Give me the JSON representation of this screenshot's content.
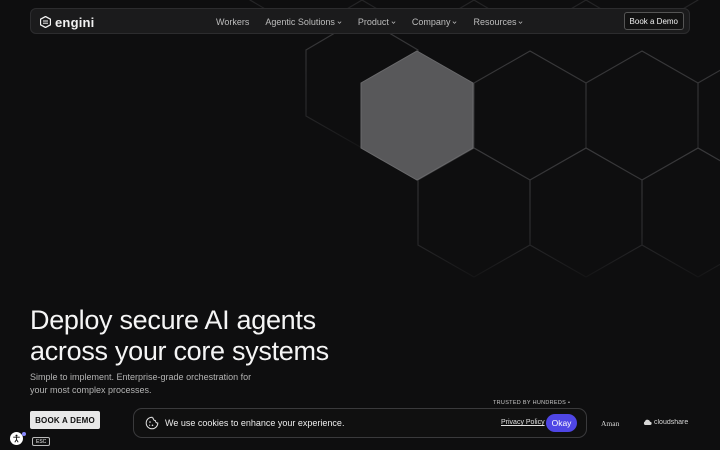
{
  "nav": {
    "logo_text": "engini",
    "items": [
      {
        "label": "Workers",
        "dropdown": false
      },
      {
        "label": "Agentic Solutions",
        "dropdown": true
      },
      {
        "label": "Product",
        "dropdown": true
      },
      {
        "label": "Company",
        "dropdown": true
      },
      {
        "label": "Resources",
        "dropdown": true
      }
    ],
    "demo_button": "Book a Demo"
  },
  "hero": {
    "title_line1": "Deploy secure AI agents",
    "title_line2": "across your core systems",
    "subtitle_line1": "Simple to implement. Enterprise-grade orchestration for",
    "subtitle_line2": "your most complex processes.",
    "cta": "BOOK A DEMO"
  },
  "trusted_label": "TRUSTED BY HUNDREDS •",
  "cookie": {
    "text": "We use cookies to enhance your experience.",
    "privacy_link": "Privacy Policy",
    "okay_button": "Okay"
  },
  "logos": {
    "aman": "Aman",
    "cloudshare": "cloudshare"
  },
  "accessibility": {
    "esc_label": "ESC"
  },
  "colors": {
    "background": "#0e0e0f",
    "highlight_hex": "#58585a",
    "okay_button": "#4f46e5"
  }
}
